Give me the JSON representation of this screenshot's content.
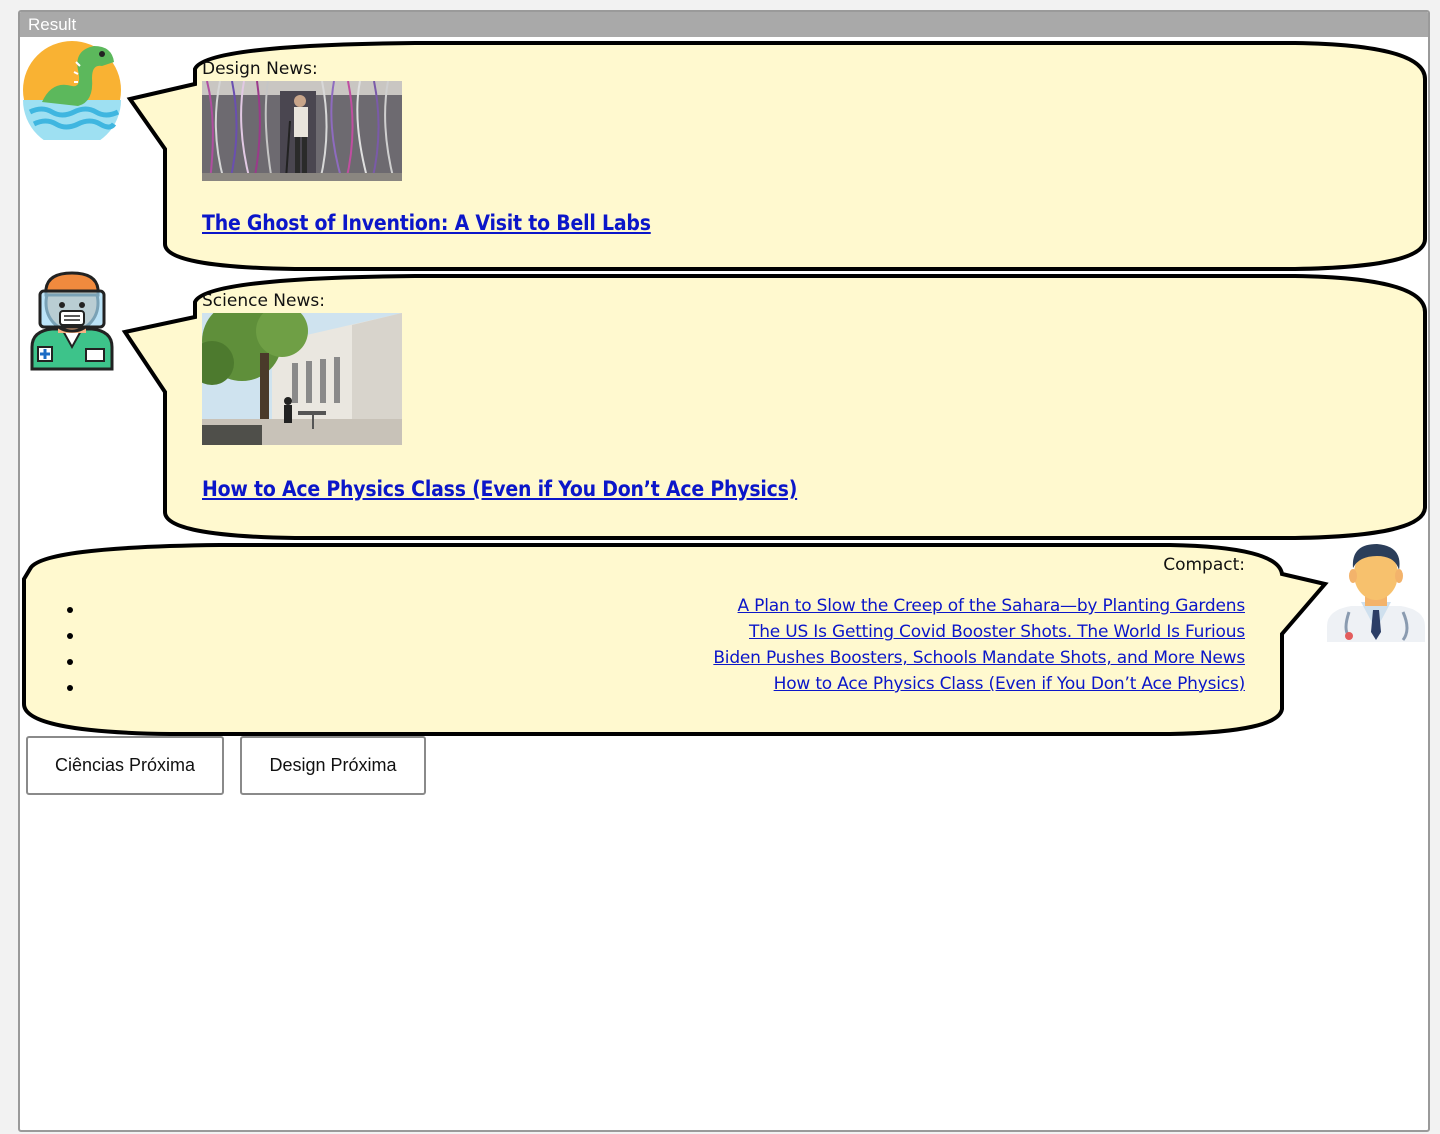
{
  "window": {
    "title": "Result"
  },
  "messages": [
    {
      "label": "Design News:",
      "headline": "The Ghost of Invention: A Visit to Bell Labs",
      "avatar": "dinosaur-avatar-icon"
    },
    {
      "label": "Science News:",
      "headline": "How to Ace Physics Class (Even if You Don’t Ace Physics)",
      "avatar": "medic-face-shield-avatar-icon"
    }
  ],
  "compact": {
    "label": "Compact:",
    "avatar": "doctor-avatar-icon",
    "links": [
      "A Plan to Slow the Creep of the Sahara—by Planting Gardens",
      "The US Is Getting Covid Booster Shots. The World Is Furious",
      "Biden Pushes Boosters, Schools Mandate Shots, and More News",
      "How to Ace Physics Class (Even if You Don’t Ace Physics)"
    ]
  },
  "buttons": {
    "science_next": "Ciências Próxima",
    "design_next": "Design Próxima"
  },
  "colors": {
    "bubble_fill": "#fff9cf",
    "link": "#0b16c9",
    "titlebar": "#a9a9a9"
  }
}
